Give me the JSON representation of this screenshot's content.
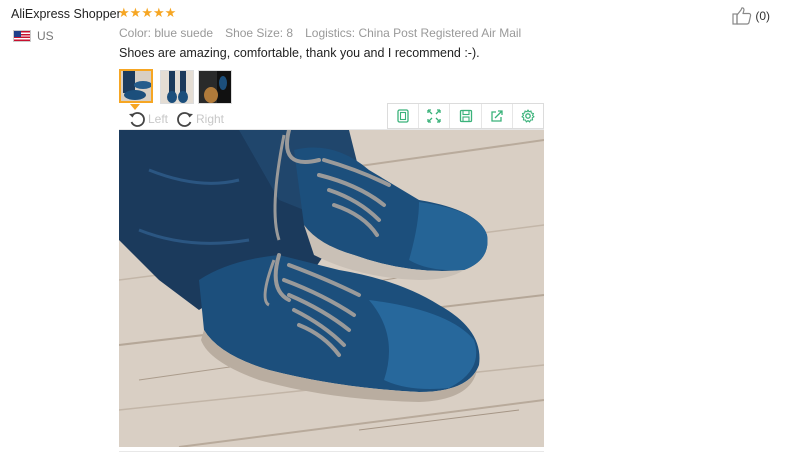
{
  "reviewer": {
    "name": "AliExpress Shopper",
    "country": "US",
    "rating_stars": 5
  },
  "meta": {
    "color": "Color: blue suede",
    "shoe_size": "Shoe Size: 8",
    "logistics": "Logistics: China Post Registered Air Mail"
  },
  "review": {
    "text": "Shoes are amazing, comfortable, thank you and I recommend :-)."
  },
  "like": {
    "count_label": "(0)"
  },
  "thumbnails": [
    {
      "name": "thumbnail-1",
      "active": true
    },
    {
      "name": "thumbnail-2",
      "active": false
    },
    {
      "name": "thumbnail-3",
      "active": false
    }
  ],
  "rotate": {
    "left_label": "Left",
    "right_label": "Right"
  },
  "toolbar": {
    "icons": [
      "fit-screen-icon",
      "fullscreen-icon",
      "save-icon",
      "share-icon",
      "settings-icon"
    ]
  },
  "colors": {
    "star": "#f6a623",
    "toolbar_icon": "#3ab27a",
    "shoe": "#1c4f7c",
    "jeans": "#1b3a5c"
  }
}
